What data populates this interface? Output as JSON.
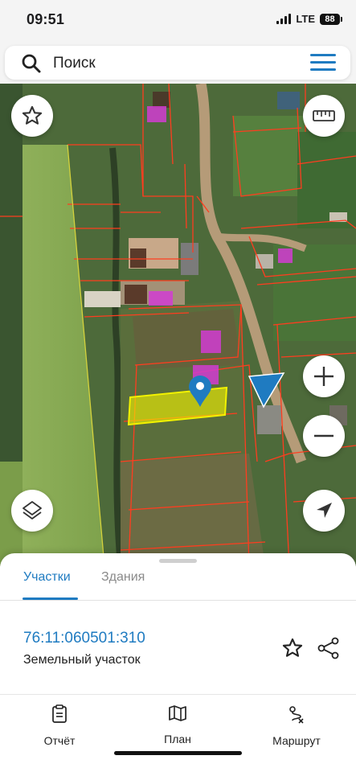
{
  "status_bar": {
    "time": "09:51",
    "network": "LTE",
    "battery": "88"
  },
  "search": {
    "placeholder": "Поиск",
    "icon": "search-icon",
    "menu_icon": "hamburger-menu-icon"
  },
  "map": {
    "controls": {
      "favorite": "star-icon",
      "ruler": "ruler-icon",
      "zoom_in": "plus-icon",
      "zoom_out": "minus-icon",
      "layers": "layers-icon",
      "locate": "location-arrow-icon"
    },
    "parcel_boundary_color": "#ff3d1f",
    "selected_parcel_color": "#f2f200",
    "building_marker_color": "#d23cd2",
    "pin_color": "#1f7bc1"
  },
  "sheet": {
    "tabs": [
      {
        "label": "Участки",
        "active": true
      },
      {
        "label": "Здания",
        "active": false
      }
    ],
    "parcel": {
      "cadastral_number": "76:11:060501:310",
      "type": "Земельный участок"
    },
    "actions": {
      "favorite": "star-outline-icon",
      "share": "share-icon"
    }
  },
  "bottom_nav": [
    {
      "label": "Отчёт",
      "icon": "report-icon"
    },
    {
      "label": "План",
      "icon": "map-icon"
    },
    {
      "label": "Маршрут",
      "icon": "route-icon"
    }
  ],
  "accent_color": "#1f7bc1"
}
